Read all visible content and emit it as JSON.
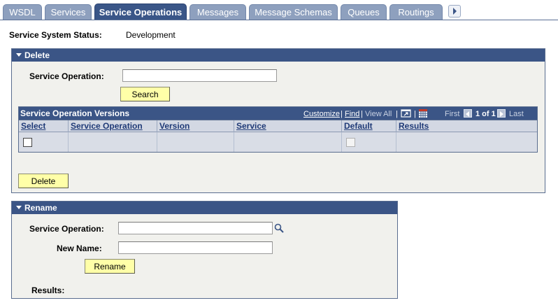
{
  "tabs": [
    {
      "label": "WSDL",
      "active": false
    },
    {
      "label": "Services",
      "active": false
    },
    {
      "label": "Service Operations",
      "active": true
    },
    {
      "label": "Messages",
      "active": false
    },
    {
      "label": "Message Schemas",
      "active": false
    },
    {
      "label": "Queues",
      "active": false
    },
    {
      "label": "Routings",
      "active": false
    }
  ],
  "status": {
    "label": "Service System Status:",
    "value": "Development"
  },
  "delete_section": {
    "title": "Delete",
    "service_operation_label": "Service Operation:",
    "service_operation_value": "",
    "search_button": "Search",
    "grid": {
      "title": "Service Operation Versions",
      "customize": "Customize",
      "find": "Find",
      "view_all": "View All",
      "pagination": {
        "first": "First",
        "range": "1 of 1",
        "last": "Last"
      },
      "columns": [
        "Select",
        "Service Operation",
        "Version",
        "Service",
        "Default",
        "Results"
      ]
    },
    "delete_button": "Delete"
  },
  "rename_section": {
    "title": "Rename",
    "service_operation_label": "Service Operation:",
    "service_operation_value": "",
    "new_name_label": "New Name:",
    "new_name_value": "",
    "rename_button": "Rename",
    "results_label": "Results:"
  },
  "colors": {
    "header_blue": "#3b5586",
    "tab_inactive": "#8ea0be",
    "button_yellow": "#ffffa8",
    "panel_bg": "#f1f1ed"
  }
}
